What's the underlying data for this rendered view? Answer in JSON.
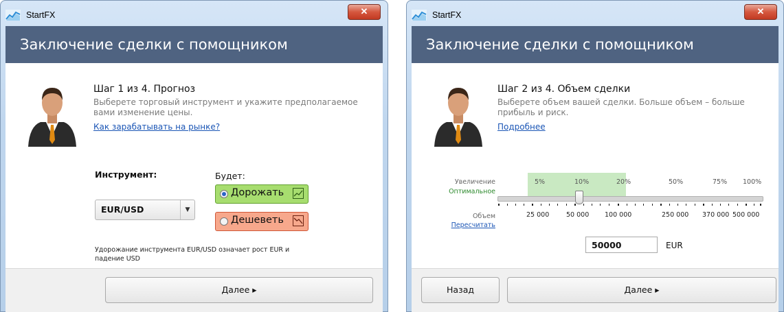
{
  "app": {
    "title": "StartFX",
    "header": "Заключение сделки с помощником",
    "close_icon": "✕"
  },
  "step1": {
    "title": "Шаг 1 из 4. Прогноз",
    "description": "Выберете торговый инструмент и укажите предполагаемое вами изменение цены.",
    "link": "Как зарабатывать на рынке?",
    "instrument_label": "Инструмент:",
    "instrument_value": "EUR/USD",
    "will_label": "Будет:",
    "options": [
      "Дорожать",
      "Дешеветь"
    ],
    "selected_option": "Дорожать",
    "note": "Удорожание инструмента EUR/USD означает рост EUR и падение USD",
    "next_button": "Далее ▸"
  },
  "step2": {
    "title": "Шаг 2 из 4. Объем сделки",
    "description": "Выберете объем вашей сделки. Больше объем – больше прибыль и риск.",
    "link": "Подробнее",
    "increase_label": "Увеличение",
    "optimal_label": "Оптимальное",
    "volume_label": "Объем",
    "recalc_link": "Пересчитать",
    "percent_labels": [
      "5%",
      "10%",
      "20%",
      "50%",
      "75%",
      "100%"
    ],
    "volume_labels": [
      "25 000",
      "50 000",
      "100 000",
      "250 000",
      "370 000",
      "500 000"
    ],
    "amount": "50000",
    "currency": "EUR",
    "back_button": "Назад",
    "next_button": "Далее ▸"
  },
  "colors": {
    "header": "#4f6381",
    "up": "#a7dd6f",
    "down": "#f7a88c",
    "optimal_band": "#c9e9c2",
    "link": "#1a55b5",
    "optimal_text": "#2d8a2d"
  }
}
